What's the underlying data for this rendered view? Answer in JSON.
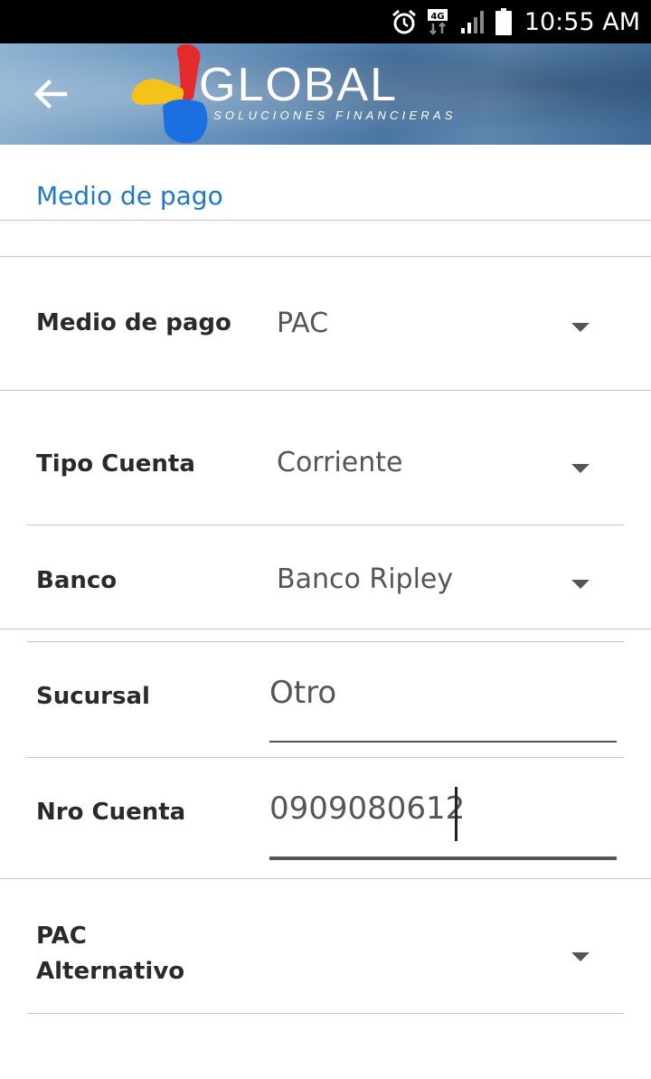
{
  "status_bar": {
    "time": "10:55 AM",
    "network": "4G",
    "icons": [
      "alarm-icon",
      "4g-data-icon",
      "signal-icon",
      "battery-icon"
    ]
  },
  "header": {
    "back_icon": "arrow-left-icon",
    "logo_name": "GLOBAL",
    "logo_tagline": "SOLUCIONES FINANCIERAS"
  },
  "section": {
    "title": "Medio de pago"
  },
  "form": {
    "medio_pago": {
      "label": "Medio de pago",
      "value": "PAC"
    },
    "tipo_cuenta": {
      "label": "Tipo Cuenta",
      "value": "Corriente"
    },
    "banco": {
      "label": "Banco",
      "value": "Banco Ripley"
    },
    "sucursal": {
      "label": "Sucursal",
      "value": "Otro"
    },
    "nro_cuenta": {
      "label": "Nro Cuenta",
      "value": "0909080612"
    },
    "pac_alternativo": {
      "label_line1": "PAC",
      "label_line2": "Alternativo",
      "value": ""
    }
  },
  "colors": {
    "accent": "#1f78c1",
    "status_bar": "#000000",
    "logo_red": "#e42a2a",
    "logo_yellow": "#f4c21a",
    "logo_blue": "#1c6fe0"
  }
}
